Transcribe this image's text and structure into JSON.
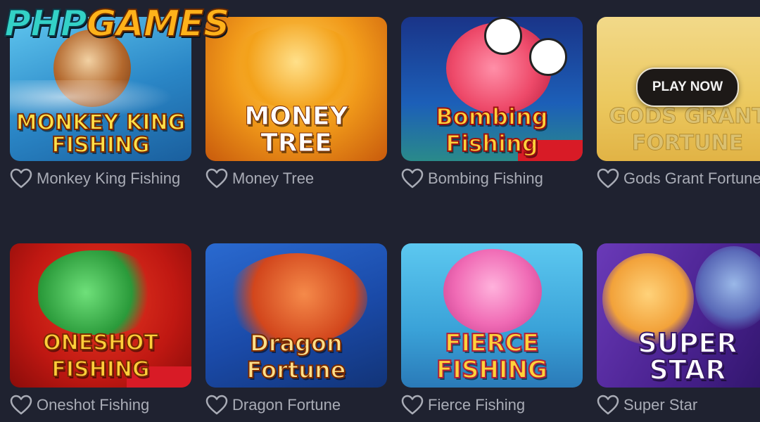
{
  "logo": {
    "part1": "PHP",
    "part2": "GAMES"
  },
  "overlay": {
    "play_label": "PLAY NOW"
  },
  "games": [
    {
      "name": "Monkey King Fishing",
      "thumb_text": "MONKEY KING FISHING",
      "bg": "#3aa7d6",
      "accent": "#f2c230"
    },
    {
      "name": "Money Tree",
      "thumb_text": "MONEY TREE",
      "bg": "#e9861a",
      "accent": "#ffd86a"
    },
    {
      "name": "Bombing Fishing",
      "thumb_text": "Bombing Fishing",
      "bg": "#1e3a9a",
      "accent": "#e8484a"
    },
    {
      "name": "Gods Grant Fortune",
      "thumb_text": "GODS GRANT FORTUNE",
      "bg": "#f1d890",
      "accent": "#e3b54a"
    },
    {
      "name": "Oneshot Fishing",
      "thumb_text": "ONESHOT FISHING",
      "bg": "#c41a16",
      "accent": "#e9a52b"
    },
    {
      "name": "Dragon Fortune",
      "thumb_text": "Dragon Fortune",
      "bg": "#1e55b8",
      "accent": "#e0562a"
    },
    {
      "name": "Fierce Fishing",
      "thumb_text": "FIERCE FISHING",
      "bg": "#49b6e2",
      "accent": "#f06bb5"
    },
    {
      "name": "Super Star",
      "thumb_text": "SUPER STAR",
      "bg": "#5b2a9c",
      "accent": "#f2b14a"
    }
  ]
}
